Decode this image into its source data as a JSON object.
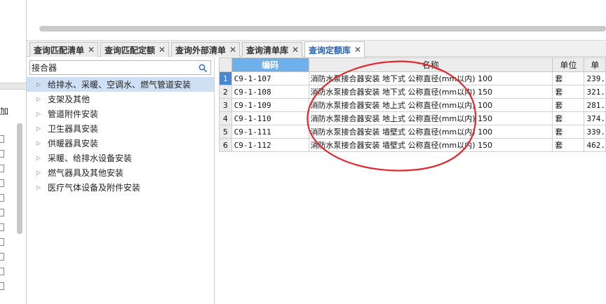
{
  "left_panel": {
    "add_label": "加"
  },
  "tabs": [
    {
      "label": "查询匹配清单",
      "active": false
    },
    {
      "label": "查询匹配定额",
      "active": false
    },
    {
      "label": "查询外部清单",
      "active": false
    },
    {
      "label": "查询清单库",
      "active": false
    },
    {
      "label": "查询定额库",
      "active": true
    }
  ],
  "tab_close_glyph": "✕",
  "search": {
    "value": "接合器",
    "icon": "search-icon"
  },
  "tree": {
    "expander_glyph": "▷",
    "items": [
      {
        "label": "给排水、采暖、空调水、燃气管道安装",
        "selected": true
      },
      {
        "label": "支架及其他",
        "selected": false
      },
      {
        "label": "管道附件安装",
        "selected": false
      },
      {
        "label": "卫生器具安装",
        "selected": false
      },
      {
        "label": "供暖器具安装",
        "selected": false
      },
      {
        "label": "采暖、给排水设备安装",
        "selected": false
      },
      {
        "label": "燃气器具及其他安装",
        "selected": false
      },
      {
        "label": "医疗气体设备及附件安装",
        "selected": false
      }
    ]
  },
  "grid": {
    "columns": {
      "code": "编码",
      "name": "名称",
      "unit": "单位",
      "price": "单"
    },
    "rows": [
      {
        "num": "1",
        "code": "C9-1-107",
        "name": "消防水泵接合器安装 地下式 公称直径(mm以内) 100",
        "unit": "套",
        "price": "239."
      },
      {
        "num": "2",
        "code": "C9-1-108",
        "name": "消防水泵接合器安装 地下式 公称直径(mm以内) 150",
        "unit": "套",
        "price": "321."
      },
      {
        "num": "3",
        "code": "C9-1-109",
        "name": "消防水泵接合器安装 地上式 公称直径(mm以内) 100",
        "unit": "套",
        "price": "281."
      },
      {
        "num": "4",
        "code": "C9-1-110",
        "name": "消防水泵接合器安装 地上式 公称直径(mm以内) 150",
        "unit": "套",
        "price": "374."
      },
      {
        "num": "5",
        "code": "C9-1-111",
        "name": "消防水泵接合器安装 墙壁式 公称直径(mm以内) 100",
        "unit": "套",
        "price": "339."
      },
      {
        "num": "6",
        "code": "C9-1-112",
        "name": "消防水泵接合器安装 墙壁式 公称直径(mm以内) 150",
        "unit": "套",
        "price": "462."
      }
    ]
  },
  "colors": {
    "accent": "#2a62b3",
    "header_highlight": "#6fb0ea",
    "row_selected": "#4a86d6",
    "tree_selected": "#cfe0f5",
    "annotation": "#e0282e"
  }
}
